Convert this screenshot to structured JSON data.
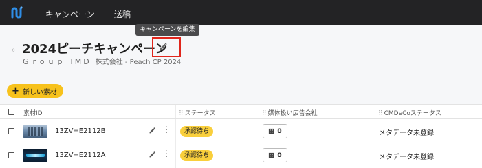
{
  "nav": {
    "items": [
      "キャンペーン",
      "送稿"
    ]
  },
  "tooltip": "キャンペーンを編集",
  "header": {
    "bullet": "◦",
    "title": "2024ピーチキャンペーン",
    "group_label": "Group",
    "group_code": "IMD",
    "subtitle_detail": "株式会社 - Peach CP 2024"
  },
  "add_button": {
    "icon": "+",
    "label": "新しい素材"
  },
  "table": {
    "columns": [
      "素材ID",
      "ステータス",
      "媒体扱い広告会社",
      "CMDeCoステータス"
    ],
    "drag_handle": "⠿",
    "rows": [
      {
        "code": "13ZV=E2112B",
        "status": "承認待ち",
        "media_count": "0",
        "cmd_status": "メタデータ未登録",
        "more": "⋮"
      },
      {
        "code": "13ZV=E2112A",
        "status": "承認待ち",
        "media_count": "0",
        "cmd_status": "メタデータ未登録",
        "more": "⋮"
      }
    ]
  },
  "colors": {
    "topbar": "#232325",
    "accent_yellow": "#f7c21c",
    "badge_yellow": "#f9cf3c",
    "highlight_red": "#e0261c",
    "logo_blue": "#2f8ee6"
  },
  "icons": {
    "logo": "app-logo-icon",
    "edit": "pencil-icon",
    "more": "more-vertical-icon",
    "media": "building-icon",
    "checkbox": "checkbox-icon",
    "drag": "drag-handle-icon"
  }
}
